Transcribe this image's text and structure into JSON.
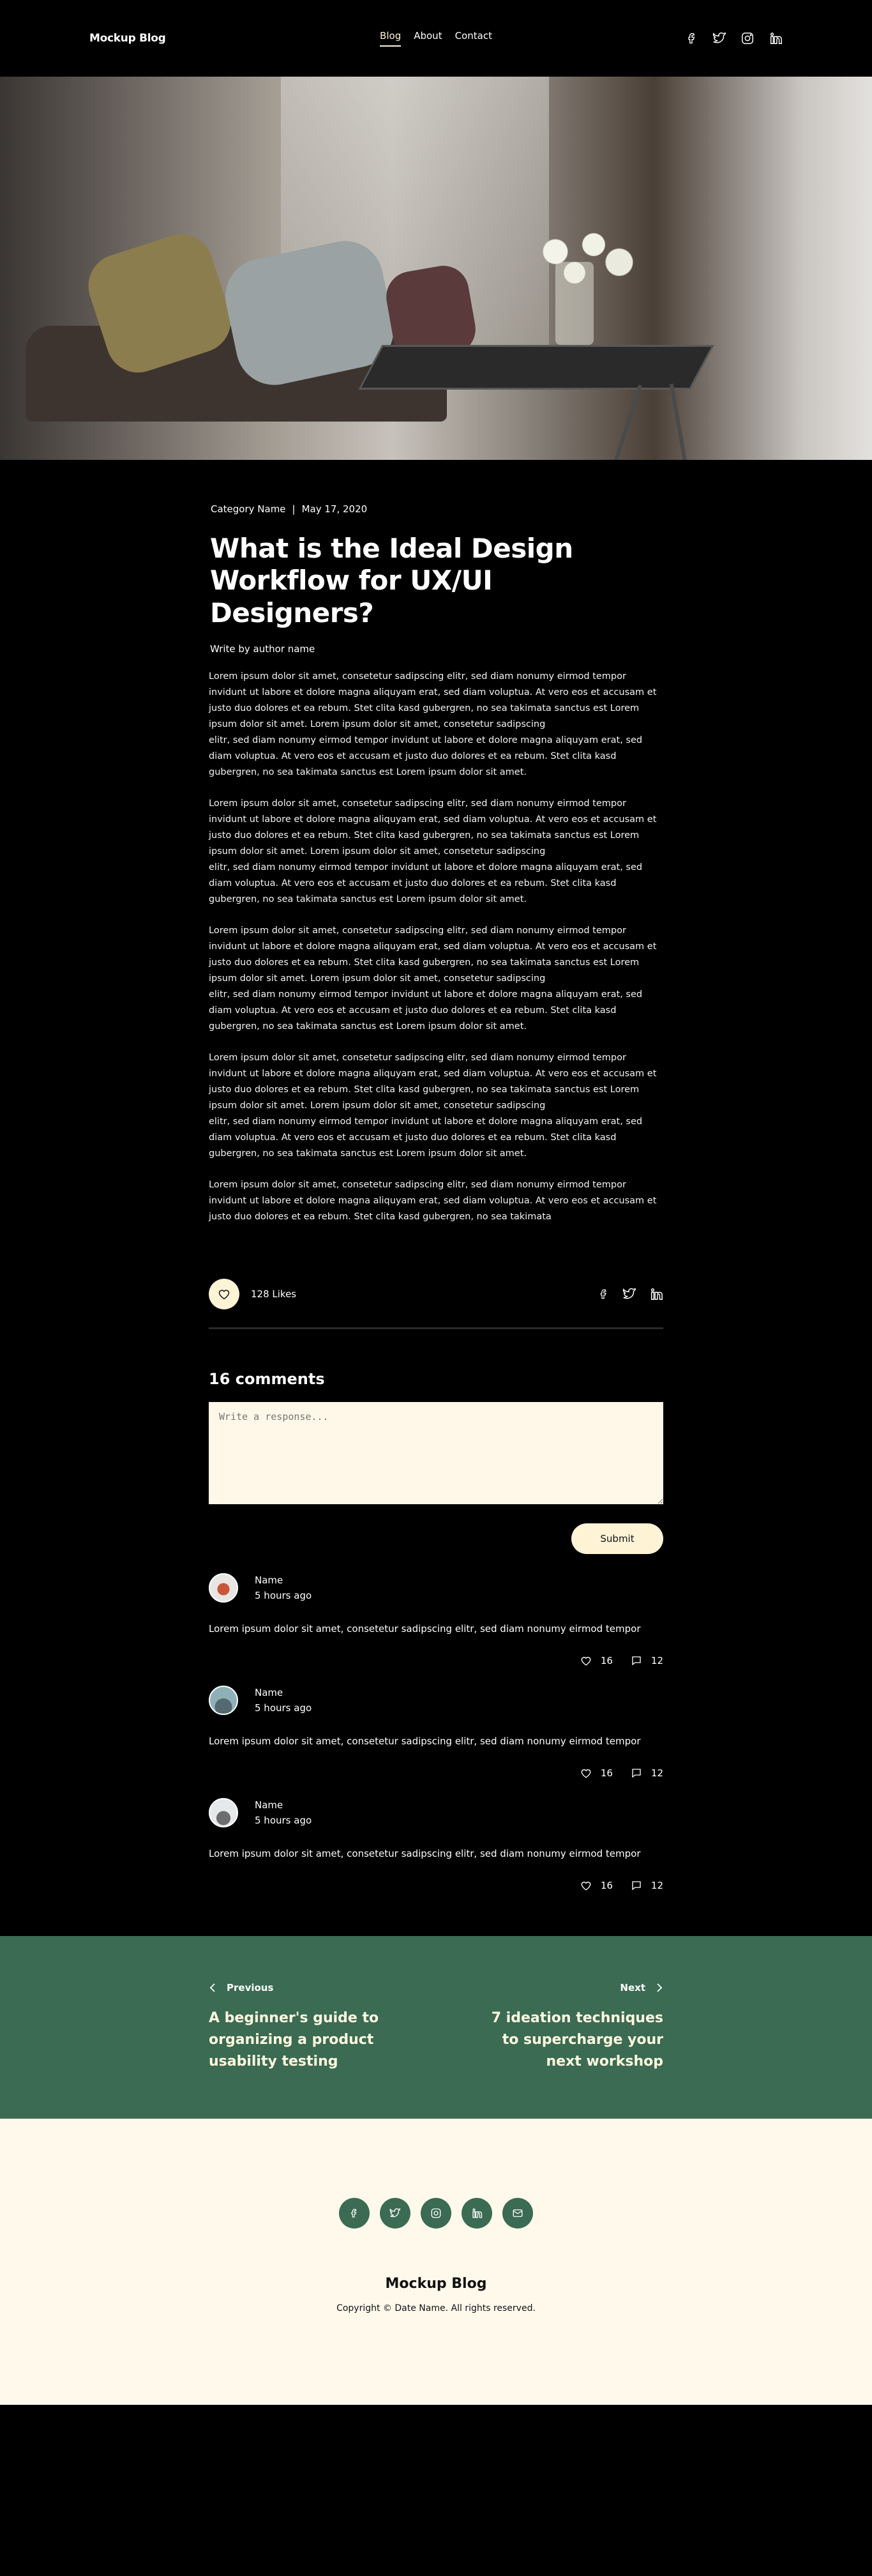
{
  "nav": {
    "brand": "Mockup Blog",
    "links": [
      "Blog",
      "About",
      "Contact"
    ],
    "social": [
      "facebook-icon",
      "twitter-icon",
      "instagram-icon",
      "linkedin-icon"
    ]
  },
  "article": {
    "category": "Category Name",
    "separator": "|",
    "date": "May 17, 2020",
    "title": "What is the Ideal Design Workflow for UX/UI Designers?",
    "author": "Write by author name",
    "paragraphs": [
      "Lorem ipsum dolor sit amet, consetetur sadipscing elitr, sed diam nonumy eirmod tempor invidunt ut labore et dolore magna aliquyam erat, sed diam voluptua. At vero eos et accusam et justo duo dolores et ea rebum. Stet clita kasd gubergren, no sea takimata sanctus est Lorem ipsum dolor sit amet. Lorem ipsum dolor sit amet, consetetur sadipscing\nelitr, sed diam nonumy eirmod tempor invidunt ut labore et dolore magna aliquyam erat, sed diam voluptua. At vero eos et accusam et justo duo dolores et ea rebum. Stet clita kasd\ngubergren, no sea takimata sanctus est Lorem ipsum dolor sit amet.",
      "Lorem ipsum dolor sit amet, consetetur sadipscing elitr, sed diam nonumy eirmod tempor invidunt ut labore et dolore magna aliquyam erat, sed diam voluptua. At vero eos et accusam et justo duo dolores et ea rebum. Stet clita kasd gubergren, no sea takimata sanctus est Lorem ipsum dolor sit amet. Lorem ipsum dolor sit amet, consetetur sadipscing\nelitr, sed diam nonumy eirmod tempor invidunt ut labore et dolore magna aliquyam erat, sed diam voluptua. At vero eos et accusam et justo duo dolores et ea rebum. Stet clita kasd\ngubergren, no sea takimata sanctus est Lorem ipsum dolor sit amet.",
      "Lorem ipsum dolor sit amet, consetetur sadipscing elitr, sed diam nonumy eirmod tempor invidunt ut labore et dolore magna aliquyam erat, sed diam voluptua. At vero eos et accusam et justo duo dolores et ea rebum. Stet clita kasd gubergren, no sea takimata sanctus est Lorem ipsum dolor sit amet. Lorem ipsum dolor sit amet, consetetur sadipscing\nelitr, sed diam nonumy eirmod tempor invidunt ut labore et dolore magna aliquyam erat, sed diam voluptua. At vero eos et accusam et justo duo dolores et ea rebum. Stet clita kasd\ngubergren, no sea takimata sanctus est Lorem ipsum dolor sit amet.",
      "Lorem ipsum dolor sit amet, consetetur sadipscing elitr, sed diam nonumy eirmod tempor invidunt ut labore et dolore magna aliquyam erat, sed diam voluptua. At vero eos et accusam et justo duo dolores et ea rebum. Stet clita kasd gubergren, no sea takimata sanctus est Lorem ipsum dolor sit amet. Lorem ipsum dolor sit amet, consetetur sadipscing\nelitr, sed diam nonumy eirmod tempor invidunt ut labore et dolore magna aliquyam erat, sed diam voluptua. At vero eos et accusam et justo duo dolores et ea rebum. Stet clita kasd\ngubergren, no sea takimata sanctus est Lorem ipsum dolor sit amet.",
      "Lorem ipsum dolor sit amet, consetetur sadipscing elitr, sed diam nonumy eirmod tempor invidunt ut labore et dolore magna aliquyam erat, sed diam voluptua. At vero eos et accusam et justo duo dolores et ea rebum. Stet clita kasd gubergren, no sea takimata"
    ],
    "likes": "128 Likes"
  },
  "comments": {
    "title": "16 comments",
    "placeholder": "Write a response...",
    "submit": "Submit",
    "items": [
      {
        "name": "Name",
        "time": "5 hours ago",
        "text": "Lorem ipsum dolor sit amet, consetetur sadipscing elitr, sed diam nonumy eirmod tempor",
        "likes": "16",
        "replies": "12"
      },
      {
        "name": "Name",
        "time": "5 hours ago",
        "text": "Lorem ipsum dolor sit amet, consetetur sadipscing elitr, sed diam nonumy eirmod tempor",
        "likes": "16",
        "replies": "12"
      },
      {
        "name": "Name",
        "time": "5 hours ago",
        "text": "Lorem ipsum dolor sit amet, consetetur sadipscing elitr, sed diam nonumy eirmod tempor",
        "likes": "16",
        "replies": "12"
      }
    ]
  },
  "pager": {
    "prev_label": "Previous",
    "prev_title": "A beginner's guide to organizing a product usability testing",
    "next_label": "Next",
    "next_title": "7 ideation techniques to supercharge your next workshop"
  },
  "footer": {
    "social": [
      "facebook-icon",
      "twitter-icon",
      "instagram-icon",
      "linkedin-icon",
      "mail-icon"
    ],
    "brand": "Mockup Blog",
    "copyright": "Copyright © Date Name. All rights reserved."
  },
  "colors": {
    "background": "#000000",
    "accent": "#fff3d6",
    "green": "#3b6b52",
    "footer_bg": "#fff9ec"
  }
}
